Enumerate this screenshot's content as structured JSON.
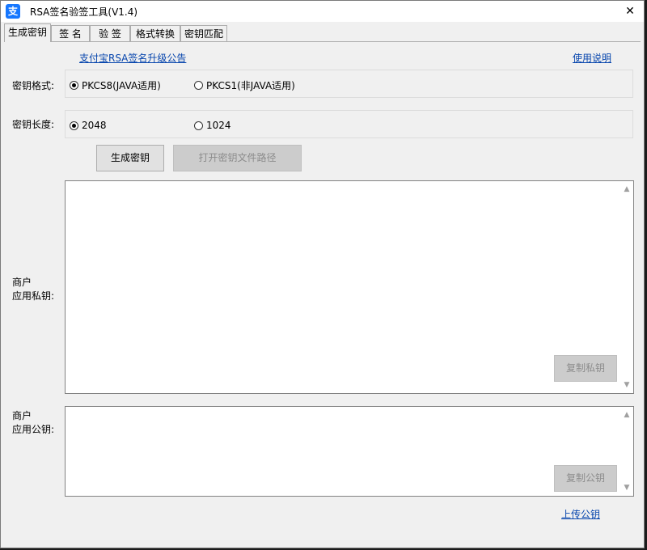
{
  "window": {
    "title": "RSA签名验签工具(V1.4)",
    "icon_char": "支",
    "close_symbol": "✕"
  },
  "tabs": [
    {
      "label": "生成密钥",
      "active": true
    },
    {
      "label": "签 名",
      "active": false
    },
    {
      "label": "验 签",
      "active": false
    },
    {
      "label": "格式转换",
      "active": false
    },
    {
      "label": "密钥匹配",
      "active": false
    }
  ],
  "links": {
    "announcement": "支付宝RSA签名升级公告",
    "help": "使用说明",
    "upload_public_key": "上传公钥"
  },
  "key_format": {
    "label": "密钥格式:",
    "options": [
      {
        "label": "PKCS8(JAVA适用)",
        "checked": true
      },
      {
        "label": "PKCS1(非JAVA适用)",
        "checked": false
      }
    ]
  },
  "key_length": {
    "label": "密钥长度:",
    "options": [
      {
        "label": "2048",
        "checked": true
      },
      {
        "label": "1024",
        "checked": false
      }
    ]
  },
  "buttons": {
    "generate": "生成密钥",
    "open_path": "打开密钥文件路径",
    "copy_private": "复制私钥",
    "copy_public": "复制公钥"
  },
  "private_key": {
    "label_line1": "商户",
    "label_line2": "应用私钥:",
    "value": ""
  },
  "public_key": {
    "label_line1": "商户",
    "label_line2": "应用公钥:",
    "value": ""
  },
  "colors": {
    "link": "#0645ad",
    "app_icon": "#1677ff"
  }
}
